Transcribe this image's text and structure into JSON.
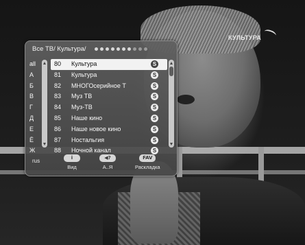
{
  "channel_logo": "КУЛЬТУРА",
  "osd": {
    "title": "Все ТВ/ Культура/",
    "page_dots": {
      "total": 10,
      "active": 7
    },
    "letters": [
      {
        "label": "all",
        "selected": true
      },
      {
        "label": "А"
      },
      {
        "label": "Б"
      },
      {
        "label": "В"
      },
      {
        "label": "Г"
      },
      {
        "label": "Д"
      },
      {
        "label": "Е"
      },
      {
        "label": "Ё"
      },
      {
        "label": "Ж"
      }
    ],
    "channels": [
      {
        "num": "80",
        "name": "Культура",
        "selected": true,
        "icon": "S"
      },
      {
        "num": "81",
        "name": "Культура",
        "icon": "S"
      },
      {
        "num": "82",
        "name": "МНОГОсерийное Т",
        "icon": "S"
      },
      {
        "num": "83",
        "name": "Муз ТВ",
        "icon": "S"
      },
      {
        "num": "84",
        "name": "Муз-ТВ",
        "icon": "S"
      },
      {
        "num": "85",
        "name": "Наше кино",
        "icon": "S"
      },
      {
        "num": "86",
        "name": "Наше новое кино",
        "icon": "S"
      },
      {
        "num": "87",
        "name": "Ностальгия",
        "icon": "S"
      },
      {
        "num": "88",
        "name": "Ночной канал",
        "icon": "S"
      }
    ],
    "footer": {
      "lang": "rus",
      "buttons": [
        {
          "key": "i",
          "label": "Вид"
        },
        {
          "key": "◀?",
          "label": "А..Я"
        },
        {
          "key": "FAV",
          "label": "Раскладка"
        }
      ]
    }
  }
}
